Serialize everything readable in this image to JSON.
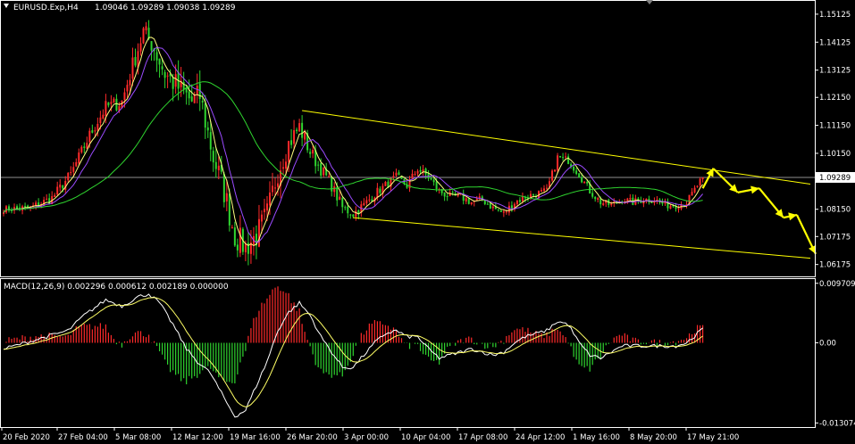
{
  "header": {
    "title": "EURUSD.Exp,H4",
    "ohlc": "1.09046 1.09289 1.09038 1.09289"
  },
  "macd_header": {
    "title": "MACD(12,26,9) 0.002296 0.000612 0.002189 0.000000"
  },
  "colors": {
    "background": "#000000",
    "bull_candle": "#ff2a2a",
    "bear_candle": "#2fd52f",
    "ma_fast": "#ffff80",
    "ma_mid": "#9b4bff",
    "ma_slow": "#2fd52f",
    "channel": "#ffff00",
    "forecast_arrow": "#ffff00",
    "hist_pos": "#ff2a2a",
    "hist_neg": "#2fd52f",
    "macd_line": "#ffffff",
    "signal_line": "#ffff66",
    "axis": "#ffffff",
    "price_line": "#c0c0c0"
  },
  "current_price": "1.09289",
  "chart_data": [
    {
      "type": "candlestick",
      "title": "EURUSD.Exp,H4",
      "ylim": [
        1.0575,
        1.156
      ],
      "y_ticks": [
        "1.15125",
        "1.14125",
        "1.13125",
        "1.12150",
        "1.11150",
        "1.10150",
        "1.09289",
        "1.08150",
        "1.07175",
        "1.06175"
      ],
      "x_ticks": [
        "20 Feb 2020",
        "27 Feb 04:00",
        "5 Mar 08:00",
        "12 Mar 12:00",
        "19 Mar 16:00",
        "26 Mar 20:00",
        "3 Apr 00:00",
        "10 Apr 04:00",
        "17 Apr 08:00",
        "24 Apr 12:00",
        "1 May 16:00",
        "8 May 20:00",
        "17 May 21:00"
      ],
      "close_anchors": [
        [
          0,
          1.0815
        ],
        [
          10,
          1.082
        ],
        [
          18,
          1.0855
        ],
        [
          25,
          1.094
        ],
        [
          32,
          1.108
        ],
        [
          38,
          1.118
        ],
        [
          44,
          1.12
        ],
        [
          48,
          1.133
        ],
        [
          52,
          1.145
        ],
        [
          55,
          1.141
        ],
        [
          60,
          1.13
        ],
        [
          65,
          1.125
        ],
        [
          70,
          1.12
        ],
        [
          73,
          1.122
        ],
        [
          78,
          1.1
        ],
        [
          82,
          1.088
        ],
        [
          86,
          1.072
        ],
        [
          90,
          1.068
        ],
        [
          94,
          1.072
        ],
        [
          98,
          1.08
        ],
        [
          102,
          1.095
        ],
        [
          106,
          1.105
        ],
        [
          110,
          1.111
        ],
        [
          114,
          1.102
        ],
        [
          118,
          1.096
        ],
        [
          122,
          1.09
        ],
        [
          126,
          1.082
        ],
        [
          130,
          1.08
        ],
        [
          134,
          1.083
        ],
        [
          138,
          1.087
        ],
        [
          142,
          1.09
        ],
        [
          146,
          1.093
        ],
        [
          150,
          1.09
        ],
        [
          154,
          1.096
        ],
        [
          158,
          1.093
        ],
        [
          162,
          1.088
        ],
        [
          166,
          1.086
        ],
        [
          170,
          1.086
        ],
        [
          174,
          1.084
        ],
        [
          178,
          1.085
        ],
        [
          182,
          1.082
        ],
        [
          186,
          1.08
        ],
        [
          190,
          1.084
        ],
        [
          194,
          1.086
        ],
        [
          198,
          1.087
        ],
        [
          202,
          1.088
        ],
        [
          206,
          1.1
        ],
        [
          210,
          1.099
        ],
        [
          214,
          1.094
        ],
        [
          218,
          1.088
        ],
        [
          222,
          1.084
        ],
        [
          226,
          1.083
        ],
        [
          230,
          1.085
        ],
        [
          234,
          1.084
        ],
        [
          238,
          1.085
        ],
        [
          242,
          1.085
        ],
        [
          246,
          1.083
        ],
        [
          250,
          1.083
        ],
        [
          254,
          1.084
        ],
        [
          258,
          1.09
        ],
        [
          260,
          1.0929
        ]
      ],
      "n_bars": 261,
      "volatility": [
        [
          0,
          0.0018
        ],
        [
          40,
          0.004
        ],
        [
          60,
          0.007
        ],
        [
          80,
          0.008
        ],
        [
          100,
          0.007
        ],
        [
          120,
          0.0035
        ],
        [
          140,
          0.0025
        ],
        [
          200,
          0.0022
        ],
        [
          260,
          0.002
        ]
      ],
      "moving_averages": [
        {
          "period": 5,
          "color_key": "ma_fast"
        },
        {
          "period": 10,
          "color_key": "ma_mid"
        },
        {
          "period": 40,
          "color_key": "ma_slow"
        }
      ],
      "upper_channel": {
        "from": [
          111,
          1.1168
        ],
        "to": [
          300,
          1.0905
        ]
      },
      "lower_channel": {
        "from": [
          130,
          1.0785
        ],
        "to": [
          300,
          1.064
        ]
      },
      "forecast_arrows": [
        [
          [
            260,
            1.089
          ],
          [
            264,
            1.0962
          ]
        ],
        [
          [
            264,
            1.096
          ],
          [
            273,
            1.0875
          ]
        ],
        [
          [
            273,
            1.0875
          ],
          [
            281,
            1.089
          ]
        ],
        [
          [
            281,
            1.089
          ],
          [
            290,
            1.0785
          ]
        ],
        [
          [
            290,
            1.0785
          ],
          [
            295,
            1.0795
          ]
        ],
        [
          [
            295,
            1.0795
          ],
          [
            302,
            1.0655
          ]
        ]
      ]
    },
    {
      "type": "macd",
      "title": "MACD(12,26,9) 0.002296 0.000612 0.002189 0.000000",
      "ylim": [
        -0.01374,
        0.0104
      ],
      "y_ticks": [
        "0.009709",
        "0.00",
        "-0.013074"
      ],
      "macd_values": [
        0.002296,
        0.000612,
        0.002189,
        0.0
      ],
      "macd_anchors": [
        [
          0,
          -0.001
        ],
        [
          8,
          0.0
        ],
        [
          16,
          0.001
        ],
        [
          24,
          0.002
        ],
        [
          30,
          0.0045
        ],
        [
          38,
          0.007
        ],
        [
          44,
          0.006
        ],
        [
          50,
          0.0075
        ],
        [
          54,
          0.008
        ],
        [
          58,
          0.0065
        ],
        [
          63,
          0.003
        ],
        [
          68,
          -0.001
        ],
        [
          72,
          -0.003
        ],
        [
          77,
          -0.005
        ],
        [
          82,
          -0.009
        ],
        [
          86,
          -0.012
        ],
        [
          90,
          -0.011
        ],
        [
          94,
          -0.007
        ],
        [
          98,
          -0.003
        ],
        [
          102,
          0.002
        ],
        [
          106,
          0.005
        ],
        [
          110,
          0.0065
        ],
        [
          114,
          0.0045
        ],
        [
          118,
          0.001
        ],
        [
          122,
          -0.0015
        ],
        [
          126,
          -0.004
        ],
        [
          130,
          -0.004
        ],
        [
          134,
          -0.002
        ],
        [
          138,
          0.0
        ],
        [
          142,
          0.0015
        ],
        [
          146,
          0.002
        ],
        [
          150,
          0.001
        ],
        [
          154,
          0.001
        ],
        [
          158,
          -0.001
        ],
        [
          162,
          -0.0025
        ],
        [
          166,
          -0.002
        ],
        [
          170,
          -0.0015
        ],
        [
          174,
          -0.001
        ],
        [
          178,
          -0.0015
        ],
        [
          182,
          -0.002
        ],
        [
          186,
          -0.0015
        ],
        [
          190,
          0.0
        ],
        [
          194,
          0.001
        ],
        [
          198,
          0.0015
        ],
        [
          202,
          0.002
        ],
        [
          206,
          0.0035
        ],
        [
          210,
          0.003
        ],
        [
          214,
          0.0
        ],
        [
          218,
          -0.002
        ],
        [
          222,
          -0.0025
        ],
        [
          226,
          -0.0015
        ],
        [
          230,
          -0.0005
        ],
        [
          234,
          -0.0005
        ],
        [
          238,
          -0.0005
        ],
        [
          242,
          -0.0005
        ],
        [
          246,
          -0.0005
        ],
        [
          250,
          -0.0005
        ],
        [
          254,
          0.0
        ],
        [
          258,
          0.0015
        ],
        [
          260,
          0.0023
        ]
      ]
    }
  ]
}
